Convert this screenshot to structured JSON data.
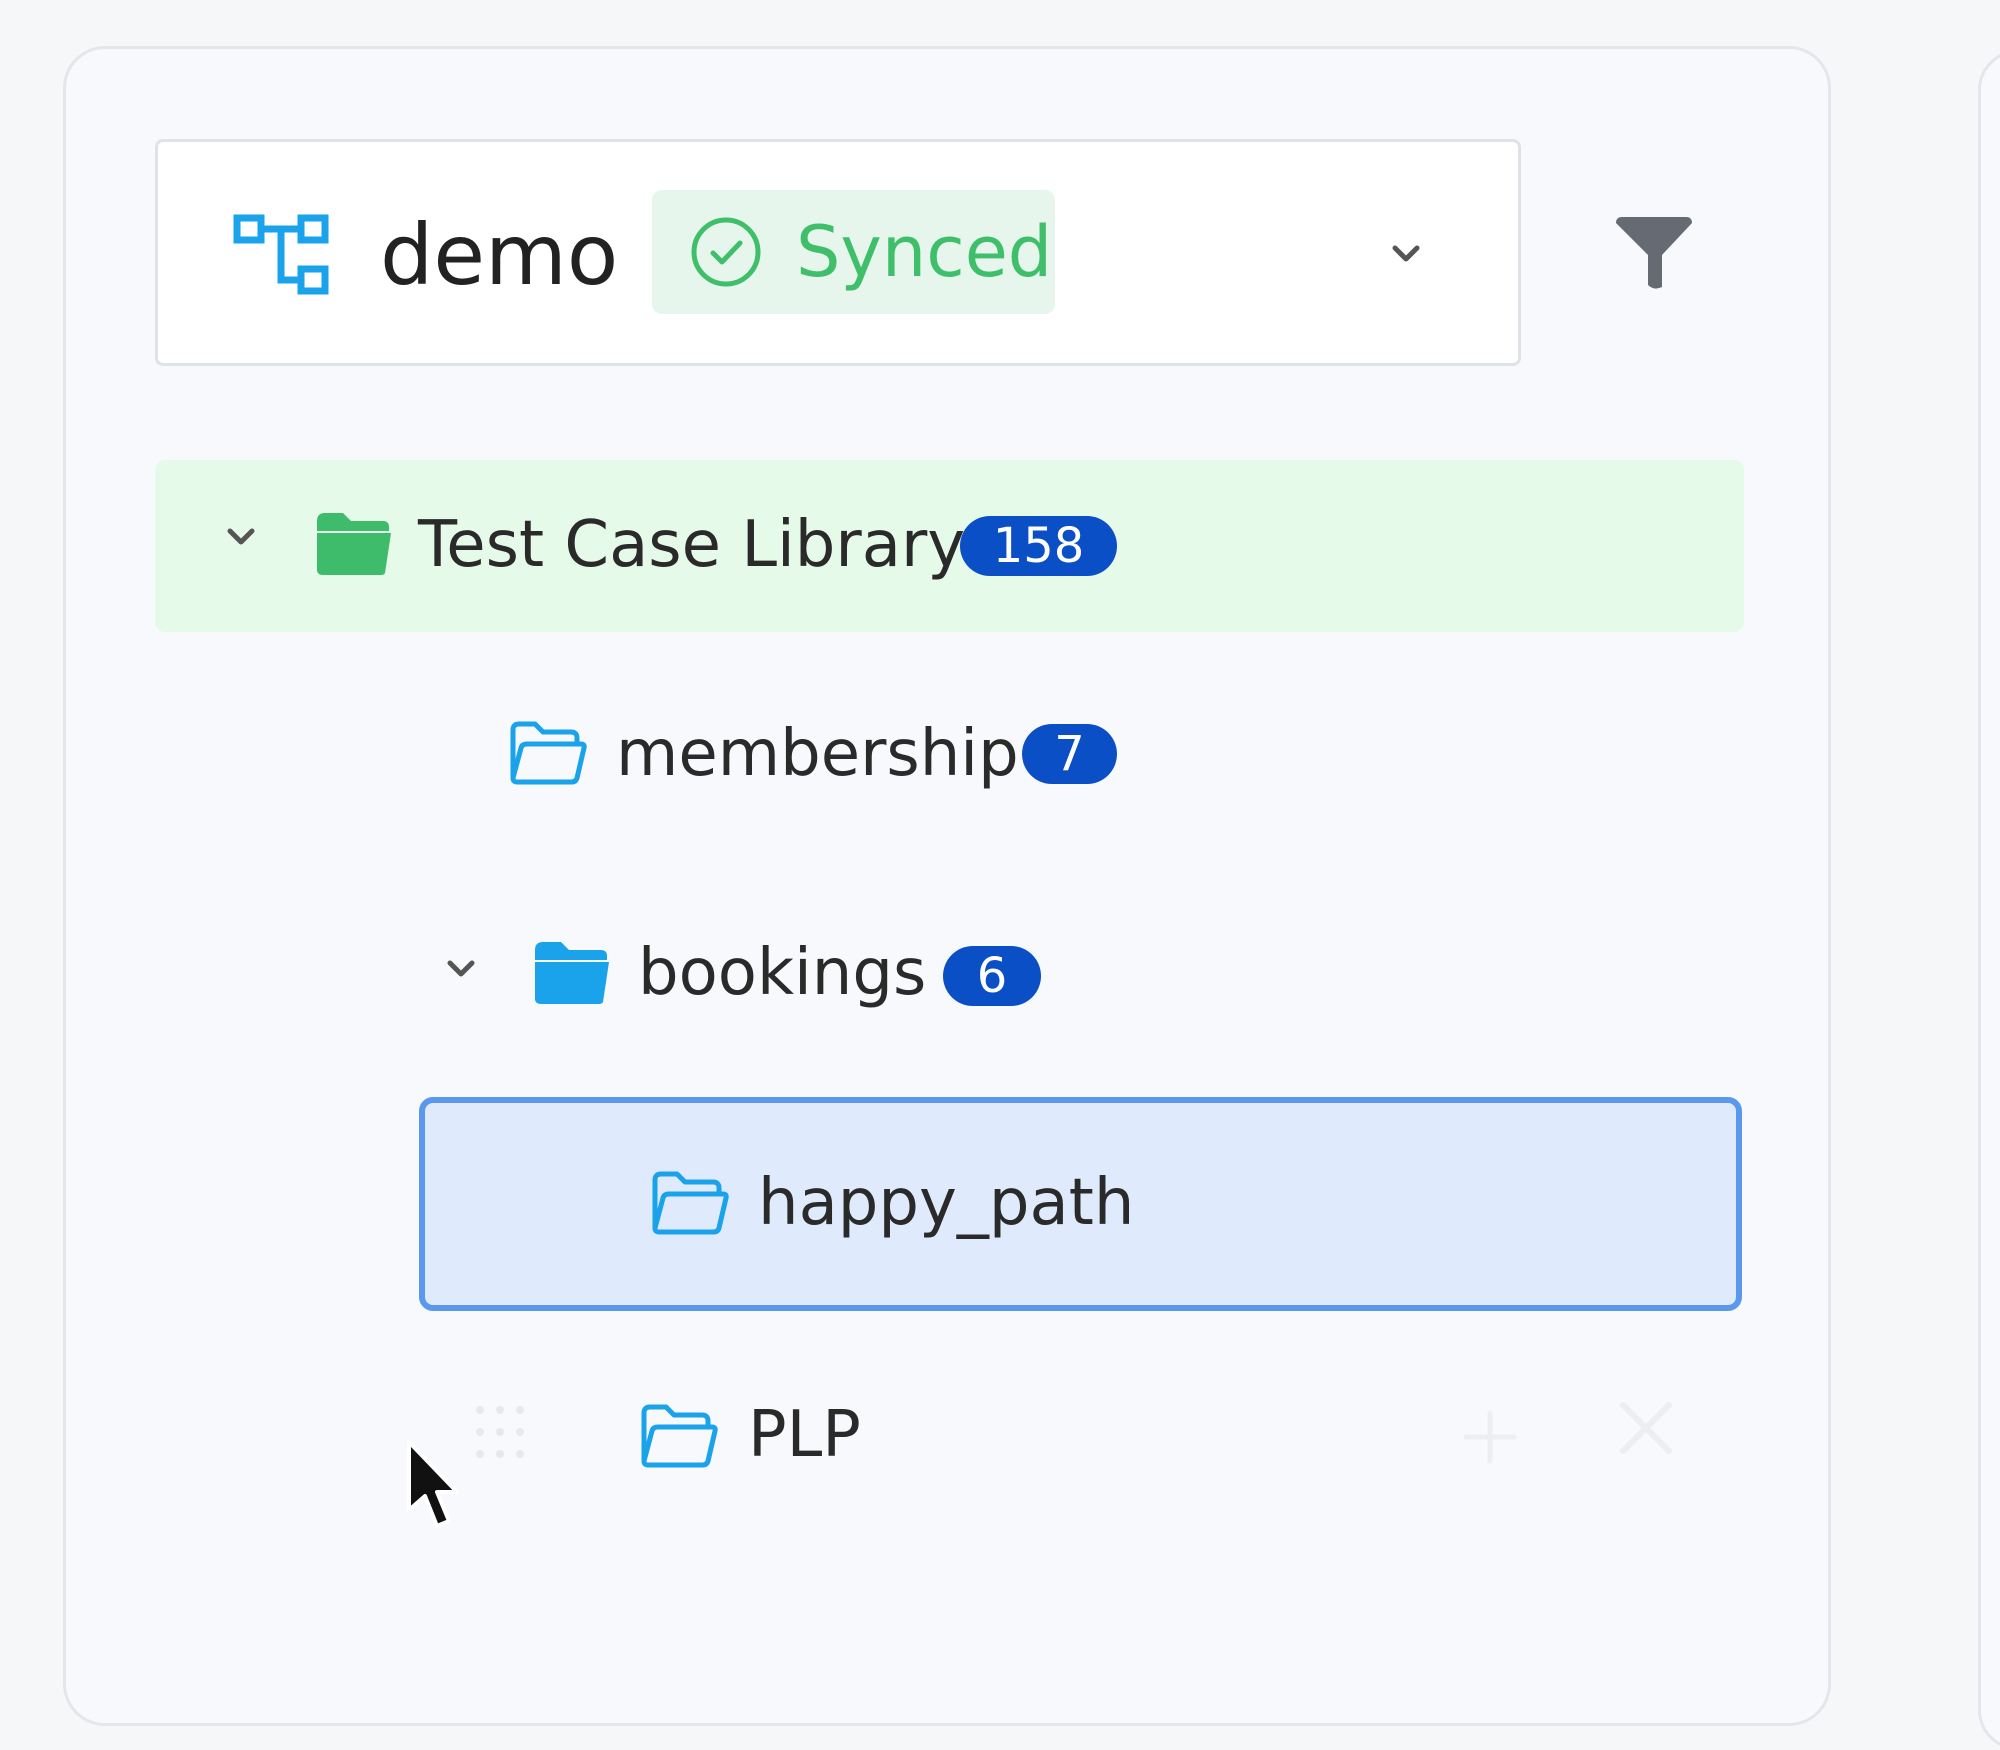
{
  "project_selector": {
    "name": "demo",
    "status": "Synced"
  },
  "tree": {
    "root": {
      "label": "Test Case Library",
      "count": "158"
    },
    "membership": {
      "label": "membership",
      "count": "7"
    },
    "bookings": {
      "label": "bookings",
      "count": "6"
    },
    "happy_path": {
      "label": "happy_path"
    },
    "plp": {
      "label": "PLP"
    }
  },
  "colors": {
    "accent_blue": "#0b4fc6",
    "synced_green": "#3fbf6a",
    "folder_green": "#3ebc6b",
    "folder_blue": "#1aa3ea",
    "selected_border": "#5a98ee"
  },
  "icons": {
    "project": "project-tree-icon",
    "sync": "check-circle-icon",
    "filter": "filter-icon",
    "expand": "chevron-down-icon",
    "folder": "folder-icon",
    "drag": "drag-handle-icon",
    "add": "plus-icon",
    "remove": "close-icon"
  }
}
